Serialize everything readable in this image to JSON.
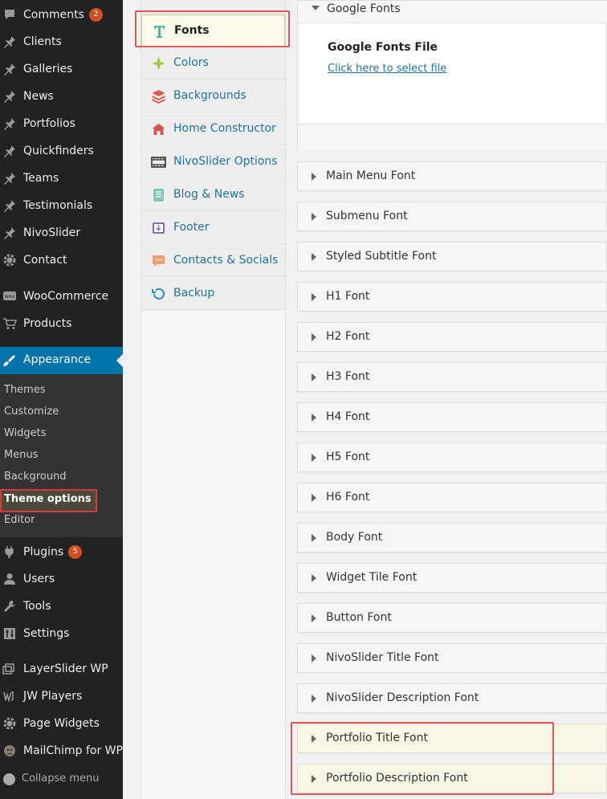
{
  "admin_menu": {
    "items_top": [
      {
        "label": "Comments",
        "badge": "2",
        "icon": "comment-icon"
      },
      {
        "label": "Clients",
        "icon": "pin-icon"
      },
      {
        "label": "Galleries",
        "icon": "pin-icon"
      },
      {
        "label": "News",
        "icon": "pin-icon"
      },
      {
        "label": "Portfolios",
        "icon": "pin-icon"
      },
      {
        "label": "Quickfinders",
        "icon": "pin-icon"
      },
      {
        "label": "Teams",
        "icon": "pin-icon"
      },
      {
        "label": "Testimonials",
        "icon": "pin-icon"
      },
      {
        "label": "NivoSlider",
        "icon": "pin-icon"
      },
      {
        "label": "Contact",
        "icon": "gear-icon"
      }
    ],
    "items_shop": [
      {
        "label": "WooCommerce",
        "icon": "woo-icon"
      },
      {
        "label": "Products",
        "icon": "cart-icon"
      }
    ],
    "appearance": {
      "label": "Appearance",
      "icon": "brush-icon"
    },
    "appearance_submenu": [
      "Themes",
      "Customize",
      "Widgets",
      "Menus",
      "Background",
      "Theme options",
      "Editor"
    ],
    "items_bottom": [
      {
        "label": "Plugins",
        "badge": "5",
        "icon": "plug-icon"
      },
      {
        "label": "Users",
        "icon": "user-icon"
      },
      {
        "label": "Tools",
        "icon": "wrench-icon"
      },
      {
        "label": "Settings",
        "icon": "settings-icon"
      }
    ],
    "items_extra": [
      {
        "label": "LayerSlider WP",
        "icon": "layers-icon"
      },
      {
        "label": "JW Players",
        "icon": "jw-icon"
      },
      {
        "label": "Page Widgets",
        "icon": "gear-icon"
      },
      {
        "label": "MailChimp for WP",
        "icon": "mailchimp-icon"
      }
    ],
    "collapse_label": "Collapse menu"
  },
  "options_nav": [
    {
      "label": "Fonts",
      "active": true,
      "icon": "fonts-icon",
      "color": "#3fbf9f"
    },
    {
      "label": "Colors",
      "icon": "colors-icon",
      "color": "#9ccc3a"
    },
    {
      "label": "Backgrounds",
      "icon": "backgrounds-icon",
      "color": "#e05a4e"
    },
    {
      "label": "Home Constructor",
      "icon": "home-icon",
      "color": "#d9534f"
    },
    {
      "label": "NivoSlider Options",
      "icon": "film-icon",
      "color": "#333333"
    },
    {
      "label": "Blog & News",
      "icon": "blog-icon",
      "color": "#7fc9b5"
    },
    {
      "label": "Footer",
      "icon": "footer-icon",
      "color": "#8a6aa8"
    },
    {
      "label": "Contacts & Socials",
      "icon": "chat-icon",
      "color": "#f0a070"
    },
    {
      "label": "Backup",
      "icon": "backup-icon",
      "color": "#2a8fc7"
    }
  ],
  "google_fonts": {
    "header": "Google Fonts",
    "title": "Google Fonts File",
    "link": "Click here to select file"
  },
  "font_sections": [
    "Main Menu Font",
    "Submenu Font",
    "Styled Subtitle Font",
    "H1 Font",
    "H2 Font",
    "H3 Font",
    "H4 Font",
    "H5 Font",
    "H6 Font",
    "Body Font",
    "Widget Tile Font",
    "Button Font",
    "NivoSlider Title Font",
    "NivoSlider Description Font",
    "Portfolio Title Font",
    "Portfolio Description Font"
  ]
}
